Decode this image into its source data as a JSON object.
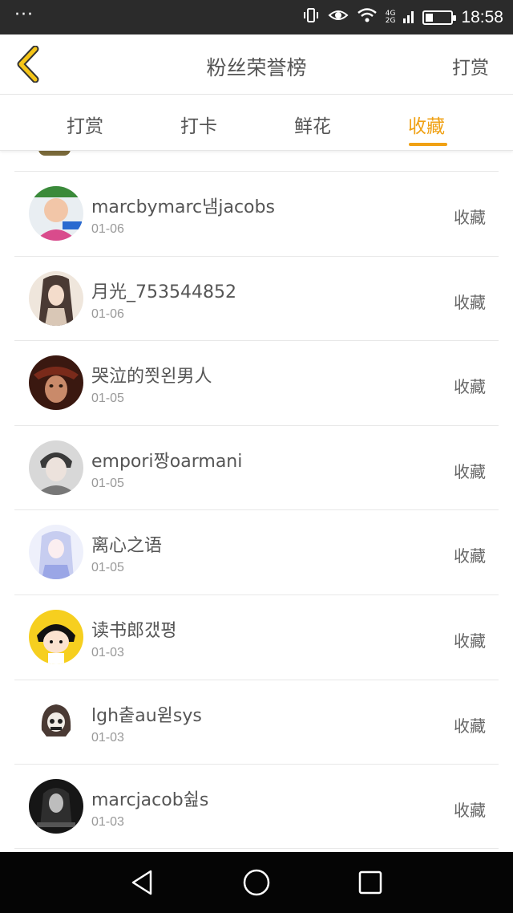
{
  "status_bar": {
    "dots": "···",
    "network": [
      "4G",
      "2G"
    ],
    "clock": "18:58",
    "battery_level": 0.3
  },
  "header": {
    "title": "粉丝荣誉榜",
    "action_label": "打赏"
  },
  "tabs": [
    {
      "label": "打赏",
      "active": false
    },
    {
      "label": "打卡",
      "active": false
    },
    {
      "label": "鲜花",
      "active": false
    },
    {
      "label": "收藏",
      "active": true
    }
  ],
  "list": {
    "items": [
      {
        "name": "marcbymarc냄jacobs",
        "date": "01-06",
        "type": "收藏",
        "avatar": "boy-cap"
      },
      {
        "name": "月光_753544852",
        "date": "01-06",
        "type": "收藏",
        "avatar": "anime-girl"
      },
      {
        "name": "哭泣的쬣왼男人",
        "date": "01-05",
        "type": "收藏",
        "avatar": "warrior"
      },
      {
        "name": "empori짱oarmani",
        "date": "01-05",
        "type": "收藏",
        "avatar": "young-man"
      },
      {
        "name": "离心之语",
        "date": "01-05",
        "type": "收藏",
        "avatar": "fantasy-girl"
      },
      {
        "name": "读书郎갰평",
        "date": "01-03",
        "type": "收藏",
        "avatar": "cartoon-girl"
      },
      {
        "name": "lgh춭au윋sys",
        "date": "01-03",
        "type": "收藏",
        "avatar": "skull-hood"
      },
      {
        "name": "marcjacob쉺s",
        "date": "01-03",
        "type": "收藏",
        "avatar": "dark-girl"
      }
    ]
  },
  "colors": {
    "accent": "#f0a114",
    "status_bar": "#2b2b2b",
    "nav_bar": "#050505"
  },
  "icons": {
    "back": "chevron-left-icon",
    "nav": [
      "back-triangle-icon",
      "home-circle-icon",
      "recent-square-icon"
    ]
  }
}
